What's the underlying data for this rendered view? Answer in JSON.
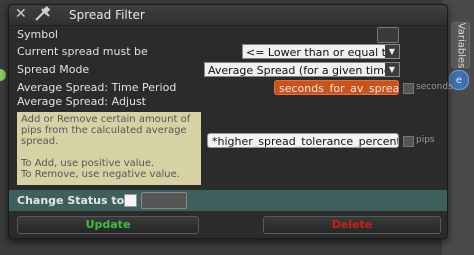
{
  "window": {
    "title": "Spread Filter",
    "side_tab_label": "Variables",
    "side_bubble_text": "e"
  },
  "fields": {
    "symbol_label": "Symbol",
    "current_spread_label": "Current spread must be",
    "current_spread_value": "<= Lower than or equal to",
    "spread_mode_label": "Spread Mode",
    "spread_mode_value": "Average Spread (for a given time)",
    "time_period_label": "Average Spread: Time Period",
    "time_period_value": "seconds_for_av_spread",
    "time_period_unit": "seconds",
    "adjust_label": "Average Spread: Adjust",
    "adjust_value": "*higher_spread_tolerance_percent%",
    "adjust_unit": "pips"
  },
  "help": {
    "lines": [
      "Add or Remove certain amount of",
      "pips from the calculated average",
      "spread.",
      "",
      "To Add, use positive value.",
      "To Remove, use negative value."
    ]
  },
  "status": {
    "label": "Change Status to"
  },
  "buttons": {
    "update_label": "Update",
    "delete_label": "Delete"
  },
  "colors": {
    "update_text": "#3fbf3f",
    "delete_text": "#cc1f1f",
    "orange_field": "#c9531e",
    "status_bar": "#3f5f5c"
  }
}
